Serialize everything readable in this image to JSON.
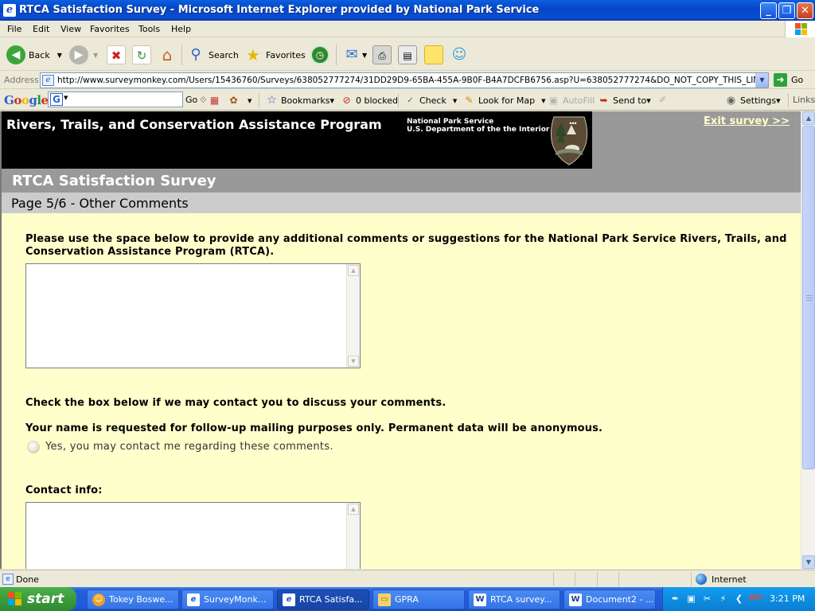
{
  "window": {
    "title": "RTCA Satisfaction Survey - Microsoft Internet Explorer provided by National Park Service",
    "minimize_glyph": "_",
    "restore_glyph": "❐",
    "close_glyph": "✕"
  },
  "menu": [
    "File",
    "Edit",
    "View",
    "Favorites",
    "Tools",
    "Help"
  ],
  "toolbar": {
    "back": "Back",
    "search": "Search",
    "favorites": "Favorites"
  },
  "address": {
    "label": "Address",
    "url": "http://www.surveymonkey.com/Users/15436760/Surveys/638052777274/31DD29D9-65BA-455A-9B0F-B4A7DCFB6756.asp?U=638052777274&DO_NOT_COPY_THIS_LINK",
    "go": "Go"
  },
  "google_bar": {
    "logo": "Google",
    "go": "Go",
    "bookmarks": "Bookmarks▾",
    "blocked": "0 blocked",
    "check": "Check",
    "look_for_map": "Look for Map",
    "autofill": "AutoFill",
    "send_to": "Send to▾",
    "settings": "Settings▾",
    "links": "Links"
  },
  "page": {
    "program_title": "Rivers, Trails, and Conservation Assistance Program",
    "nps_line1": "National Park Service",
    "nps_line2": "U.S. Department of the the Interior",
    "exit_link": "Exit survey >>",
    "survey_title": "RTCA Satisfaction Survey",
    "page_title": "Page 5/6 - Other Comments",
    "q1_line1": "Please use the space below to provide any additional comments or suggestions for the National Park Service Rivers, Trails, and",
    "q1_line2": "Conservation Assistance Program (RTCA).",
    "comments_value": "",
    "contact_prompt": "Check the box below if we may contact you to discuss your comments.",
    "name_note": "Your name is requested for follow-up mailing purposes only. Permanent data will be anonymous.",
    "contact_option": "Yes, you may contact me regarding these comments.",
    "contact_info_label": "Contact info:",
    "contact_info_value": ""
  },
  "status": {
    "text": "Done",
    "zone": "Internet"
  },
  "taskbar": {
    "start": "start",
    "tasks": [
      {
        "label": "Tokey Boswe...",
        "icon_color": "#f0a020"
      },
      {
        "label": "SurveyMonk...",
        "icon_color": "#ffffff"
      },
      {
        "label": "RTCA Satisfa...",
        "icon_color": "#ffffff"
      },
      {
        "label": "GPRA",
        "icon_color": "#f6d36a"
      },
      {
        "label": "RTCA survey...",
        "icon_color": "#ffffff"
      },
      {
        "label": "Document2 - ...",
        "icon_color": "#ffffff"
      }
    ],
    "clock": "3:21 PM"
  }
}
